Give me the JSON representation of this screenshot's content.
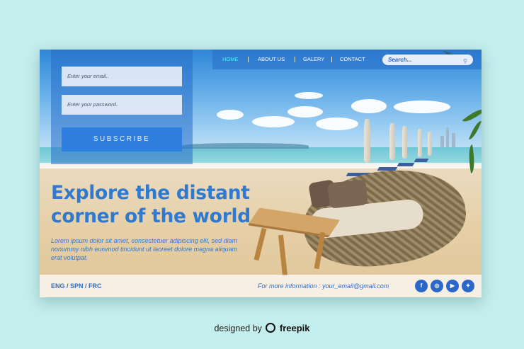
{
  "nav": {
    "items": [
      "HOME",
      "ABOUT US",
      "GALERY",
      "CONTACT"
    ],
    "active": "HOME",
    "search_placeholder": "Search..."
  },
  "form": {
    "email_placeholder": "Enter your email..",
    "password_placeholder": "Enter your password..",
    "subscribe_label": "SUBSCRIBE"
  },
  "hero": {
    "headline_line1": "Explore the distant",
    "headline_line2": "corner of the world",
    "body": "Lorem ipsum dolor sit amet, consectetuer adipiscing elit, sed diam nonummy nibh euismod tincidunt ut laoreet dolore magna aliquam erat volutpat."
  },
  "footer": {
    "languages": "ENG / SPN / FRC",
    "contact": "For more information : your_email@gmail.com",
    "social": [
      {
        "name": "facebook-icon",
        "glyph": "f"
      },
      {
        "name": "instagram-icon",
        "glyph": "◎"
      },
      {
        "name": "youtube-icon",
        "glyph": "▶"
      },
      {
        "name": "twitter-icon",
        "glyph": "✦"
      }
    ]
  },
  "credit": {
    "prefix": "designed by",
    "brand": "freepik"
  },
  "colors": {
    "background": "#c4eeed",
    "accent": "#2f7ad0",
    "overlay": "#286ec8",
    "nav_active": "#4df0ff"
  }
}
